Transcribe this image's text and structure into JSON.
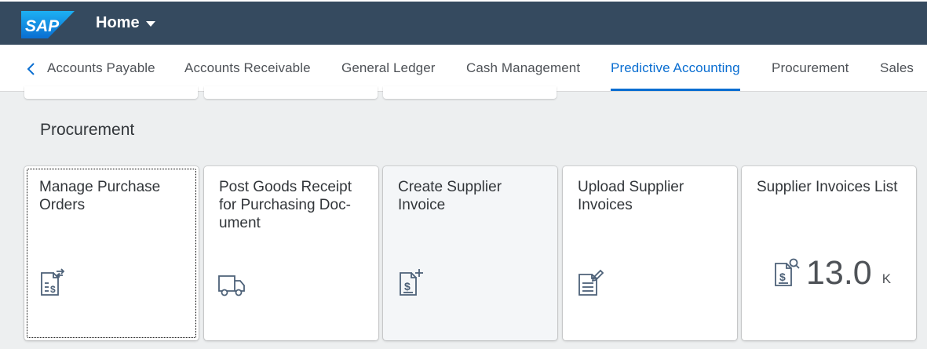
{
  "shell": {
    "logo_text": "SAP",
    "home_label": "Home"
  },
  "tabs": [
    {
      "label": "Accounts Payable",
      "active": false
    },
    {
      "label": "Accounts Receivable",
      "active": false
    },
    {
      "label": "General Ledger",
      "active": false
    },
    {
      "label": "Cash Management",
      "active": false
    },
    {
      "label": "Predictive Accounting",
      "active": true
    },
    {
      "label": "Procurement",
      "active": false
    },
    {
      "label": "Sales",
      "active": false
    }
  ],
  "section": {
    "title": "Procurement"
  },
  "tiles": [
    {
      "title": "Manage Purchase Orders",
      "icon": "purchase-order-transfer-icon"
    },
    {
      "title": "Post Goods Receipt for Purchasing Doc-ument",
      "icon": "truck-icon"
    },
    {
      "title": "Create Supplier Invoice",
      "icon": "invoice-add-icon"
    },
    {
      "title": "Upload Supplier Invoices",
      "icon": "invoice-edit-icon"
    },
    {
      "title": "Supplier Invoices List",
      "icon": "invoice-search-icon",
      "kpi_value": "13.0",
      "kpi_unit": "K"
    }
  ],
  "colors": {
    "shell_bar": "#354a5f",
    "accent": "#0a6ed1",
    "background": "#edeff0"
  }
}
